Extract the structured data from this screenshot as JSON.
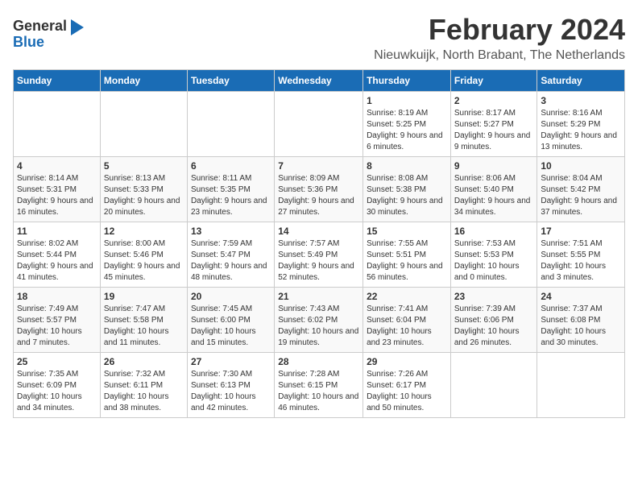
{
  "logo": {
    "general": "General",
    "blue": "Blue"
  },
  "title": "February 2024",
  "subtitle": "Nieuwkuijk, North Brabant, The Netherlands",
  "headers": [
    "Sunday",
    "Monday",
    "Tuesday",
    "Wednesday",
    "Thursday",
    "Friday",
    "Saturday"
  ],
  "weeks": [
    [
      {
        "day": "",
        "info": ""
      },
      {
        "day": "",
        "info": ""
      },
      {
        "day": "",
        "info": ""
      },
      {
        "day": "",
        "info": ""
      },
      {
        "day": "1",
        "info": "Sunrise: 8:19 AM\nSunset: 5:25 PM\nDaylight: 9 hours\nand 6 minutes."
      },
      {
        "day": "2",
        "info": "Sunrise: 8:17 AM\nSunset: 5:27 PM\nDaylight: 9 hours\nand 9 minutes."
      },
      {
        "day": "3",
        "info": "Sunrise: 8:16 AM\nSunset: 5:29 PM\nDaylight: 9 hours\nand 13 minutes."
      }
    ],
    [
      {
        "day": "4",
        "info": "Sunrise: 8:14 AM\nSunset: 5:31 PM\nDaylight: 9 hours\nand 16 minutes."
      },
      {
        "day": "5",
        "info": "Sunrise: 8:13 AM\nSunset: 5:33 PM\nDaylight: 9 hours\nand 20 minutes."
      },
      {
        "day": "6",
        "info": "Sunrise: 8:11 AM\nSunset: 5:35 PM\nDaylight: 9 hours\nand 23 minutes."
      },
      {
        "day": "7",
        "info": "Sunrise: 8:09 AM\nSunset: 5:36 PM\nDaylight: 9 hours\nand 27 minutes."
      },
      {
        "day": "8",
        "info": "Sunrise: 8:08 AM\nSunset: 5:38 PM\nDaylight: 9 hours\nand 30 minutes."
      },
      {
        "day": "9",
        "info": "Sunrise: 8:06 AM\nSunset: 5:40 PM\nDaylight: 9 hours\nand 34 minutes."
      },
      {
        "day": "10",
        "info": "Sunrise: 8:04 AM\nSunset: 5:42 PM\nDaylight: 9 hours\nand 37 minutes."
      }
    ],
    [
      {
        "day": "11",
        "info": "Sunrise: 8:02 AM\nSunset: 5:44 PM\nDaylight: 9 hours\nand 41 minutes."
      },
      {
        "day": "12",
        "info": "Sunrise: 8:00 AM\nSunset: 5:46 PM\nDaylight: 9 hours\nand 45 minutes."
      },
      {
        "day": "13",
        "info": "Sunrise: 7:59 AM\nSunset: 5:47 PM\nDaylight: 9 hours\nand 48 minutes."
      },
      {
        "day": "14",
        "info": "Sunrise: 7:57 AM\nSunset: 5:49 PM\nDaylight: 9 hours\nand 52 minutes."
      },
      {
        "day": "15",
        "info": "Sunrise: 7:55 AM\nSunset: 5:51 PM\nDaylight: 9 hours\nand 56 minutes."
      },
      {
        "day": "16",
        "info": "Sunrise: 7:53 AM\nSunset: 5:53 PM\nDaylight: 10 hours\nand 0 minutes."
      },
      {
        "day": "17",
        "info": "Sunrise: 7:51 AM\nSunset: 5:55 PM\nDaylight: 10 hours\nand 3 minutes."
      }
    ],
    [
      {
        "day": "18",
        "info": "Sunrise: 7:49 AM\nSunset: 5:57 PM\nDaylight: 10 hours\nand 7 minutes."
      },
      {
        "day": "19",
        "info": "Sunrise: 7:47 AM\nSunset: 5:58 PM\nDaylight: 10 hours\nand 11 minutes."
      },
      {
        "day": "20",
        "info": "Sunrise: 7:45 AM\nSunset: 6:00 PM\nDaylight: 10 hours\nand 15 minutes."
      },
      {
        "day": "21",
        "info": "Sunrise: 7:43 AM\nSunset: 6:02 PM\nDaylight: 10 hours\nand 19 minutes."
      },
      {
        "day": "22",
        "info": "Sunrise: 7:41 AM\nSunset: 6:04 PM\nDaylight: 10 hours\nand 23 minutes."
      },
      {
        "day": "23",
        "info": "Sunrise: 7:39 AM\nSunset: 6:06 PM\nDaylight: 10 hours\nand 26 minutes."
      },
      {
        "day": "24",
        "info": "Sunrise: 7:37 AM\nSunset: 6:08 PM\nDaylight: 10 hours\nand 30 minutes."
      }
    ],
    [
      {
        "day": "25",
        "info": "Sunrise: 7:35 AM\nSunset: 6:09 PM\nDaylight: 10 hours\nand 34 minutes."
      },
      {
        "day": "26",
        "info": "Sunrise: 7:32 AM\nSunset: 6:11 PM\nDaylight: 10 hours\nand 38 minutes."
      },
      {
        "day": "27",
        "info": "Sunrise: 7:30 AM\nSunset: 6:13 PM\nDaylight: 10 hours\nand 42 minutes."
      },
      {
        "day": "28",
        "info": "Sunrise: 7:28 AM\nSunset: 6:15 PM\nDaylight: 10 hours\nand 46 minutes."
      },
      {
        "day": "29",
        "info": "Sunrise: 7:26 AM\nSunset: 6:17 PM\nDaylight: 10 hours\nand 50 minutes."
      },
      {
        "day": "",
        "info": ""
      },
      {
        "day": "",
        "info": ""
      }
    ]
  ]
}
